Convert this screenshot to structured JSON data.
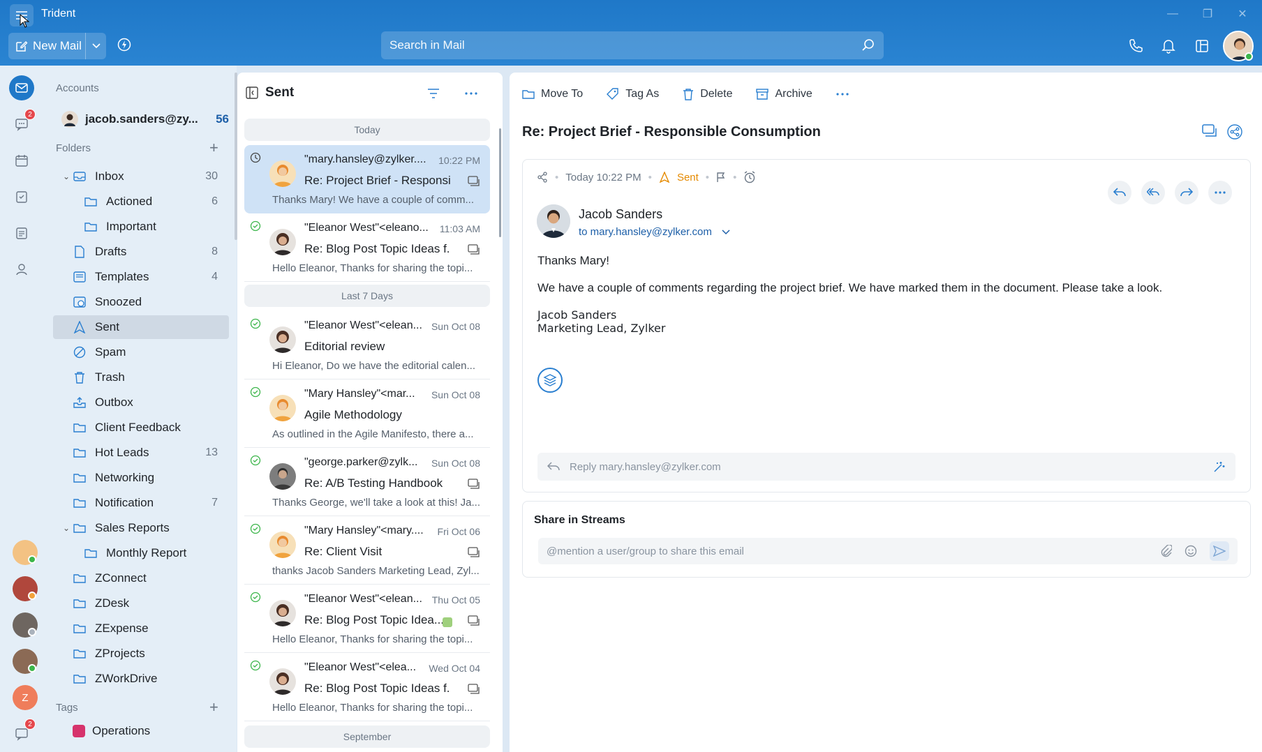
{
  "app": {
    "title": "Trident"
  },
  "toolbar": {
    "new_mail": "New Mail",
    "search_placeholder": "Search in Mail"
  },
  "rail": {
    "chat_badge": "2",
    "bottom_badge": "2",
    "z_avatar": "Z"
  },
  "sidebar": {
    "accounts_header": "Accounts",
    "account": {
      "email": "jacob.sanders@zy...",
      "count": "56"
    },
    "folders_header": "Folders",
    "folders": [
      {
        "label": "Inbox",
        "count": "30"
      },
      {
        "label": "Actioned",
        "count": "6"
      },
      {
        "label": "Important",
        "count": ""
      },
      {
        "label": "Drafts",
        "count": "8"
      },
      {
        "label": "Templates",
        "count": "4"
      },
      {
        "label": "Snoozed",
        "count": ""
      },
      {
        "label": "Sent",
        "count": ""
      },
      {
        "label": "Spam",
        "count": ""
      },
      {
        "label": "Trash",
        "count": ""
      },
      {
        "label": "Outbox",
        "count": ""
      },
      {
        "label": "Client Feedback",
        "count": ""
      },
      {
        "label": "Hot Leads",
        "count": "13"
      },
      {
        "label": "Networking",
        "count": ""
      },
      {
        "label": "Notification",
        "count": "7"
      },
      {
        "label": "Sales Reports",
        "count": ""
      },
      {
        "label": "Monthly Report",
        "count": ""
      },
      {
        "label": "ZConnect",
        "count": ""
      },
      {
        "label": "ZDesk",
        "count": ""
      },
      {
        "label": "ZExpense",
        "count": ""
      },
      {
        "label": "ZProjects",
        "count": ""
      },
      {
        "label": "ZWorkDrive",
        "count": ""
      }
    ],
    "tags_header": "Tags",
    "tags": [
      {
        "label": "Operations",
        "color": "#d6336c"
      }
    ]
  },
  "list": {
    "title": "Sent",
    "groups": [
      "Today",
      "Last 7 Days",
      "September"
    ],
    "mails": [
      {
        "from": "\"mary.hansley@zylker....",
        "time": "10:22 PM",
        "subject": "Re: Project Brief - Responsi...",
        "preview": "Thanks Mary! We have a couple of comm..."
      },
      {
        "from": "\"Eleanor West\"<eleano...",
        "time": "11:03 AM",
        "subject": "Re: Blog Post Topic Ideas f...",
        "preview": "Hello Eleanor, Thanks for sharing the topi..."
      },
      {
        "from": "\"Eleanor West\"<elean...",
        "time": "Sun Oct 08",
        "subject": "Editorial review",
        "preview": "Hi Eleanor, Do we have the editorial calen..."
      },
      {
        "from": "\"Mary Hansley\"<mar...",
        "time": "Sun Oct 08",
        "subject": "Agile Methodology",
        "preview": "As outlined in the Agile Manifesto, there a..."
      },
      {
        "from": "\"george.parker@zylk...",
        "time": "Sun Oct 08",
        "subject": "Re: A/B Testing Handbook",
        "preview": "Thanks George, we'll take a look at this! Ja..."
      },
      {
        "from": "\"Mary Hansley\"<mary....",
        "time": "Fri Oct 06",
        "subject": "Re: Client Visit",
        "preview": "thanks Jacob Sanders Marketing Lead, Zyl..."
      },
      {
        "from": "\"Eleanor West\"<elean...",
        "time": "Thu Oct 05",
        "subject": "Re: Blog Post Topic Idea...",
        "preview": "Hello Eleanor, Thanks for sharing the topi..."
      },
      {
        "from": "\"Eleanor West\"<elea...",
        "time": "Wed Oct 04",
        "subject": "Re: Blog Post Topic Ideas f...",
        "preview": "Hello Eleanor, Thanks for sharing the topi..."
      }
    ]
  },
  "reader": {
    "actions": {
      "move": "Move To",
      "tag": "Tag As",
      "delete": "Delete",
      "archive": "Archive"
    },
    "subject": "Re: Project Brief - Responsible Consumption",
    "time": "Today 10:22 PM",
    "status": "Sent",
    "sender": "Jacob Sanders",
    "to": "to mary.hansley@zylker.com",
    "greeting": "Thanks Mary!",
    "body": "We have a couple of comments regarding the project brief. We have marked them in the document. Please take a look.",
    "sig_name": "Jacob Sanders",
    "sig_title": "Marketing Lead, Zylker",
    "reply_placeholder": "Reply mary.hansley@zylker.com",
    "share_title": "Share in Streams",
    "share_placeholder": "@mention a user/group to share this email"
  },
  "colors": {
    "accent": "#2a84d2",
    "sent": "#e58a00",
    "badge": "#e5484d"
  }
}
